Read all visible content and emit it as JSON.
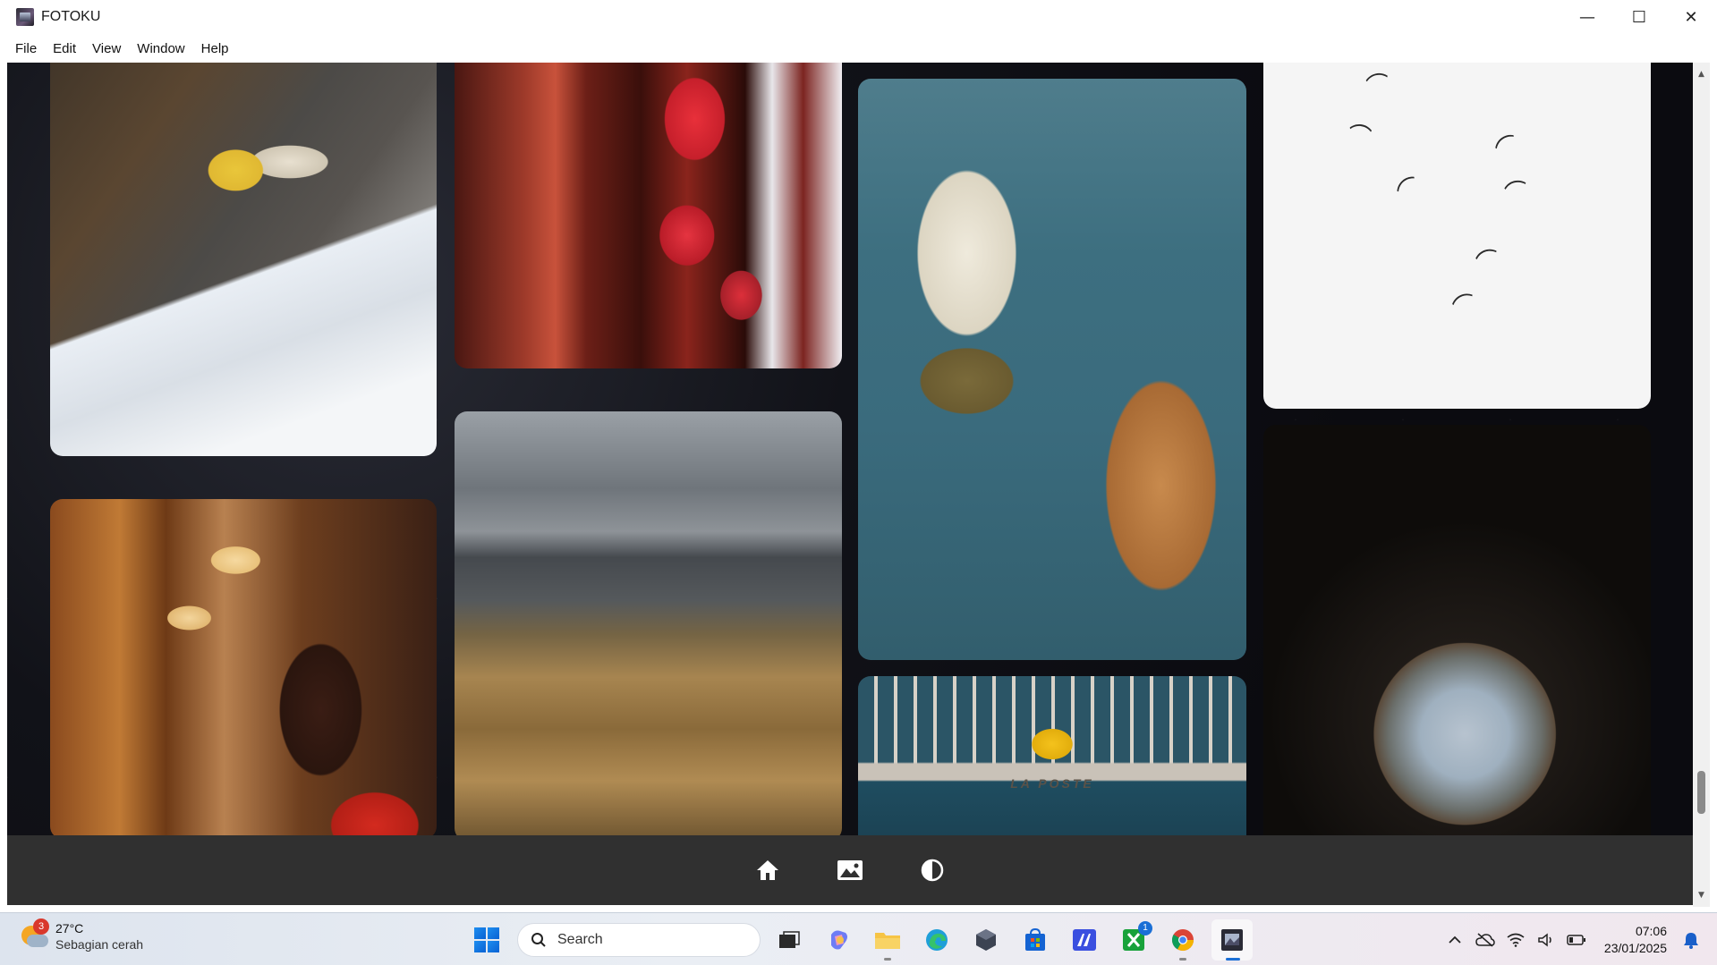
{
  "window": {
    "title": "FOTOKU",
    "controls": {
      "minimize": "—",
      "maximize": "☐",
      "close": "✕"
    }
  },
  "menu": {
    "items": [
      {
        "label": "File"
      },
      {
        "label": "Edit"
      },
      {
        "label": "View"
      },
      {
        "label": "Window"
      },
      {
        "label": "Help"
      }
    ]
  },
  "gallery": {
    "photos": [
      {
        "subject": "yellow train on snowy railway"
      },
      {
        "subject": "red chinese lanterns"
      },
      {
        "subject": "cloudy mountain over golden hills"
      },
      {
        "subject": "person feeding a deer"
      },
      {
        "subject": "La Poste building facade",
        "sign": "LA POSTE"
      },
      {
        "subject": "seagulls flying on white sky"
      },
      {
        "subject": "person in tunnel facing mountains"
      },
      {
        "subject": "woman drinking from a glass"
      }
    ]
  },
  "bottom_nav": {
    "items": [
      {
        "icon": "home-icon"
      },
      {
        "icon": "image-icon"
      },
      {
        "icon": "contrast-icon"
      }
    ]
  },
  "taskbar": {
    "weather": {
      "temp": "27°C",
      "condition": "Sebagian cerah",
      "badge": "3"
    },
    "search": {
      "placeholder": "Search"
    },
    "apps": [
      {
        "icon": "task-view-icon"
      },
      {
        "icon": "copilot-icon"
      },
      {
        "icon": "file-explorer-icon"
      },
      {
        "icon": "edge-icon"
      },
      {
        "icon": "app-cube-icon"
      },
      {
        "icon": "store-icon"
      },
      {
        "icon": "editor-icon"
      },
      {
        "icon": "xbox-icon",
        "badge": "1"
      },
      {
        "icon": "chrome-icon"
      },
      {
        "icon": "fotoku-icon"
      }
    ],
    "clock": {
      "time": "07:06",
      "date": "23/01/2025"
    }
  },
  "colors": {
    "bottom_bar": "#303030",
    "gallery_bg": "#0d0d12",
    "accent": "#1a6fd6"
  }
}
